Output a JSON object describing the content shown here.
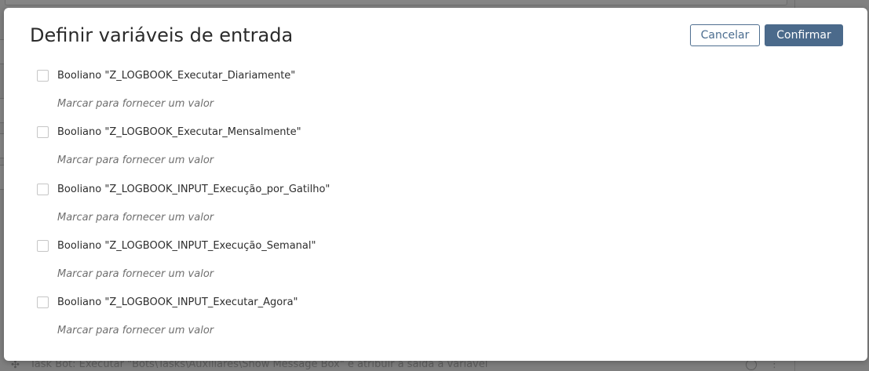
{
  "dialog": {
    "title": "Definir variáveis de entrada",
    "cancel_label": "Cancelar",
    "confirm_label": "Confirmar",
    "hint": "Marcar para fornecer um valor",
    "variables": [
      {
        "label": "Booliano \"Z_LOGBOOK_Executar_Diariamente\"",
        "checked": false
      },
      {
        "label": "Booliano \"Z_LOGBOOK_Executar_Mensalmente\"",
        "checked": false
      },
      {
        "label": "Booliano \"Z_LOGBOOK_INPUT_Execução_por_Gatilho\"",
        "checked": false
      },
      {
        "label": "Booliano \"Z_LOGBOOK_INPUT_Execução_Semanal\"",
        "checked": false
      },
      {
        "label": "Booliano \"Z_LOGBOOK_INPUT_Executar_Agora\"",
        "checked": false
      }
    ]
  },
  "background": {
    "row_text": "Task Bot: Executar \"Bots\\Tasks\\Auxiliares\\Show Message Box\" e atribuir a saída a variável"
  },
  "colors": {
    "primary": "#4b6a8b",
    "overlay": "#7f7f7f"
  }
}
